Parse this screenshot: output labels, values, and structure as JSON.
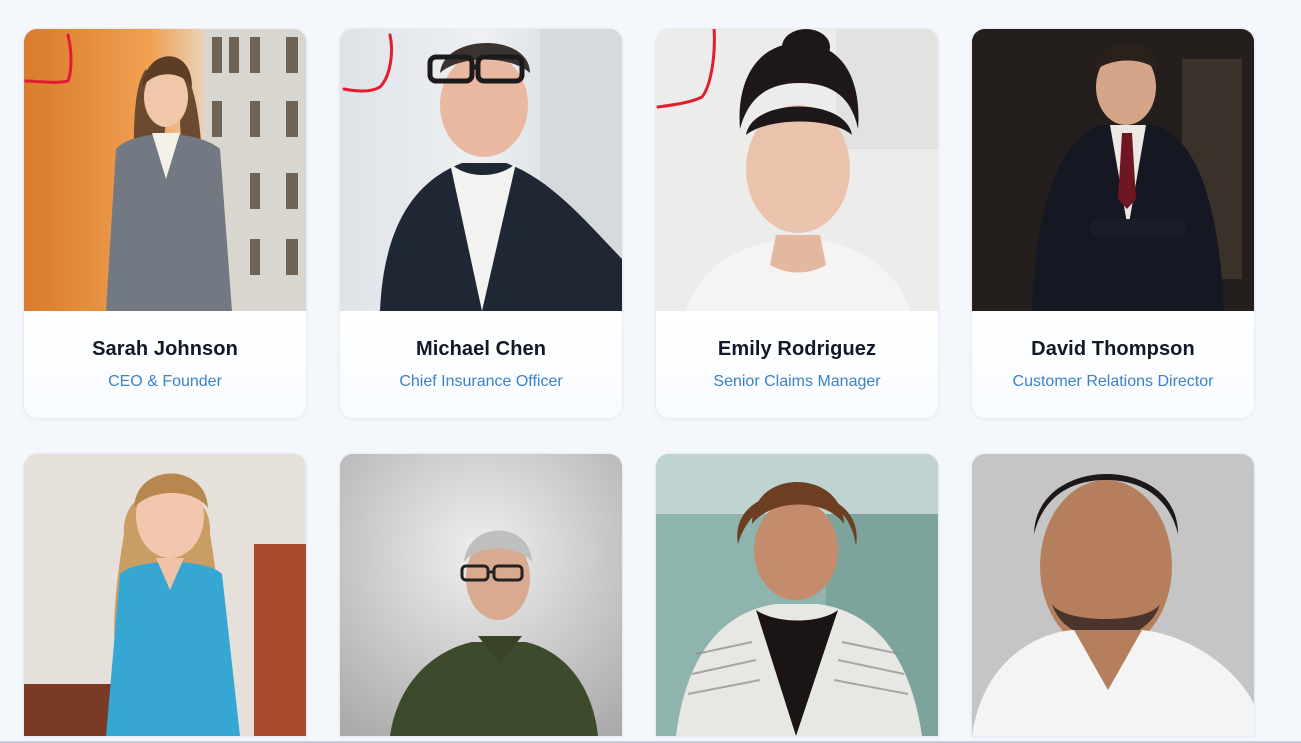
{
  "team": {
    "members": [
      {
        "name": "Sarah Johnson",
        "role": "CEO & Founder"
      },
      {
        "name": "Michael Chen",
        "role": "Chief Insurance Officer"
      },
      {
        "name": "Emily Rodriguez",
        "role": "Senior Claims Manager"
      },
      {
        "name": "David Thompson",
        "role": "Customer Relations Director"
      },
      {
        "name": "",
        "role": ""
      },
      {
        "name": "",
        "role": ""
      },
      {
        "name": "",
        "role": ""
      },
      {
        "name": "",
        "role": ""
      }
    ]
  },
  "colors": {
    "page_background": "#f4f7fb",
    "name_text": "#111827",
    "role_text": "#3b82c8",
    "annotation_mark": "#e11d2e"
  }
}
